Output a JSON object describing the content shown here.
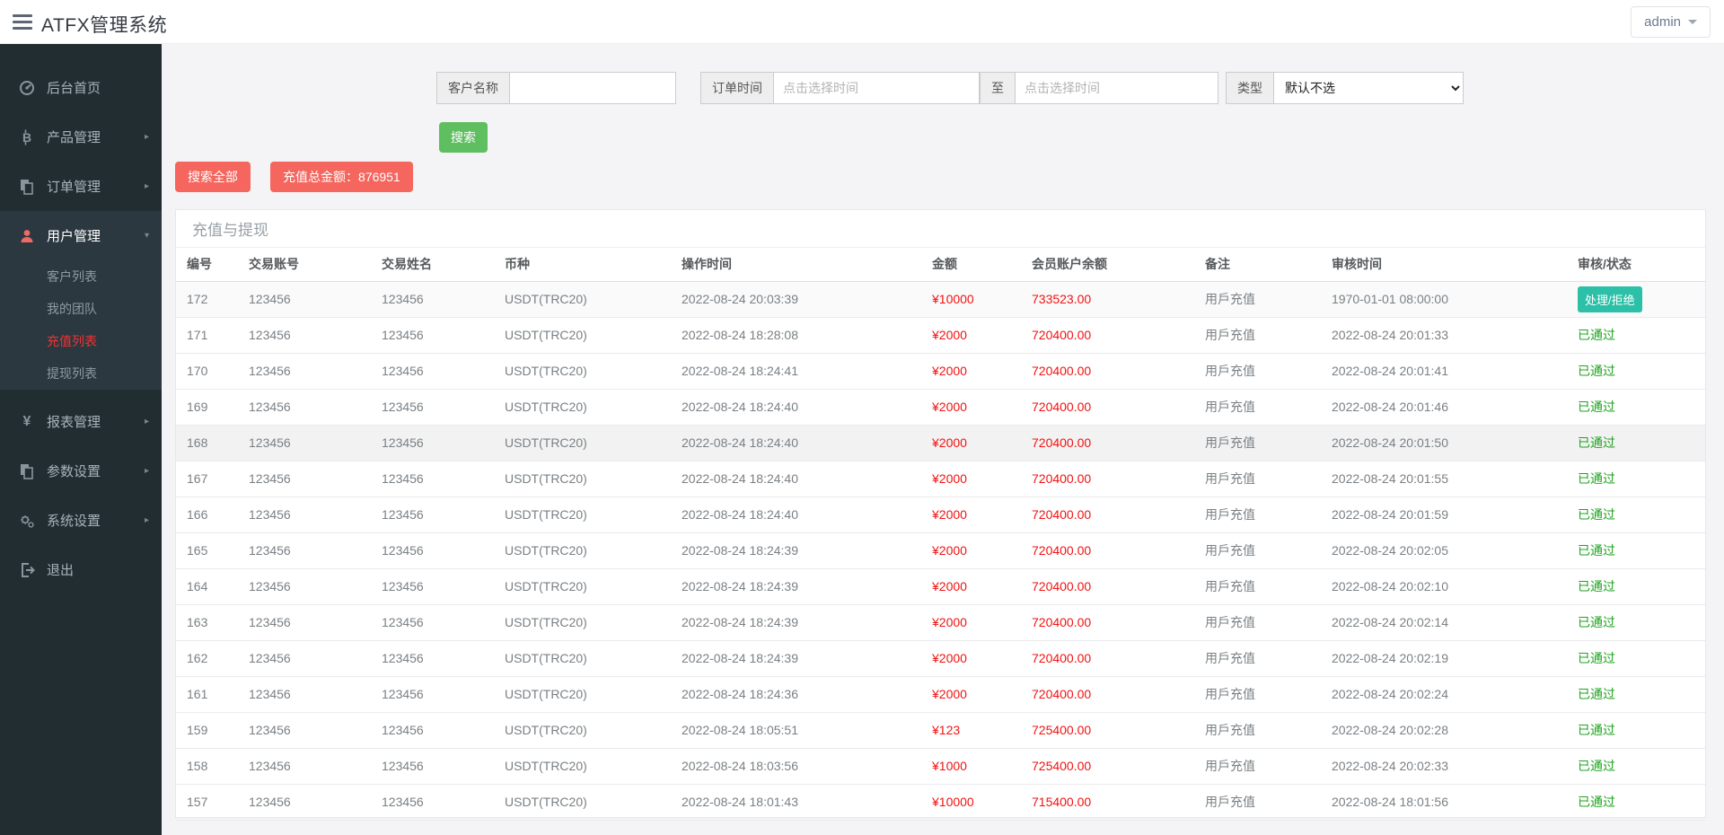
{
  "header": {
    "title": "ATFX管理系统",
    "user_menu": "admin"
  },
  "sidebar": {
    "items": [
      {
        "label": "后台首页",
        "icon": "dashboard-icon"
      },
      {
        "label": "产品管理",
        "icon": "bitcoin-icon"
      },
      {
        "label": "订单管理",
        "icon": "orders-icon"
      },
      {
        "label": "用户管理",
        "icon": "user-icon",
        "children": [
          {
            "label": "客户列表"
          },
          {
            "label": "我的团队"
          },
          {
            "label": "充值列表",
            "active": true
          },
          {
            "label": "提现列表"
          }
        ]
      },
      {
        "label": "报表管理",
        "icon": "yen-icon"
      },
      {
        "label": "参数设置",
        "icon": "params-icon"
      },
      {
        "label": "系统设置",
        "icon": "gears-icon"
      },
      {
        "label": "退出",
        "icon": "logout-icon"
      }
    ]
  },
  "filters": {
    "customer_name_label": "客户名称",
    "customer_name_value": "",
    "order_time_label": "订单时间",
    "time_placeholder": "点击选择时间",
    "to_label": "至",
    "type_label": "类型",
    "type_value": "默认不选",
    "search_button": "搜索",
    "search_all_button": "搜索全部",
    "recharge_total_button": "充值总金额：876951"
  },
  "panel": {
    "title": "充值与提现",
    "columns": [
      "编号",
      "交易账号",
      "交易姓名",
      "币种",
      "操作时间",
      "金额",
      "会员账户余额",
      "备注",
      "审核时间",
      "审核/状态"
    ],
    "rows": [
      {
        "id": "172",
        "account": "123456",
        "name": "123456",
        "currency": "USDT(TRC20)",
        "op_time": "2022-08-24 20:03:39",
        "amount": "¥10000",
        "balance": "733523.00",
        "note": "用戶充值",
        "audit_time": "1970-01-01 08:00:00",
        "status": "处理/拒绝",
        "status_type": "button",
        "bg": "#fafafa"
      },
      {
        "id": "171",
        "account": "123456",
        "name": "123456",
        "currency": "USDT(TRC20)",
        "op_time": "2022-08-24 18:28:08",
        "amount": "¥2000",
        "balance": "720400.00",
        "note": "用戶充值",
        "audit_time": "2022-08-24 20:01:33",
        "status": "已通过",
        "status_type": "text",
        "bg": null
      },
      {
        "id": "170",
        "account": "123456",
        "name": "123456",
        "currency": "USDT(TRC20)",
        "op_time": "2022-08-24 18:24:41",
        "amount": "¥2000",
        "balance": "720400.00",
        "note": "用戶充值",
        "audit_time": "2022-08-24 20:01:41",
        "status": "已通过",
        "status_type": "text",
        "bg": null
      },
      {
        "id": "169",
        "account": "123456",
        "name": "123456",
        "currency": "USDT(TRC20)",
        "op_time": "2022-08-24 18:24:40",
        "amount": "¥2000",
        "balance": "720400.00",
        "note": "用戶充值",
        "audit_time": "2022-08-24 20:01:46",
        "status": "已通过",
        "status_type": "text",
        "bg": null
      },
      {
        "id": "168",
        "account": "123456",
        "name": "123456",
        "currency": "USDT(TRC20)",
        "op_time": "2022-08-24 18:24:40",
        "amount": "¥2000",
        "balance": "720400.00",
        "note": "用戶充值",
        "audit_time": "2022-08-24 20:01:50",
        "status": "已通过",
        "status_type": "text",
        "bg": "#f2f2f2"
      },
      {
        "id": "167",
        "account": "123456",
        "name": "123456",
        "currency": "USDT(TRC20)",
        "op_time": "2022-08-24 18:24:40",
        "amount": "¥2000",
        "balance": "720400.00",
        "note": "用戶充值",
        "audit_time": "2022-08-24 20:01:55",
        "status": "已通过",
        "status_type": "text",
        "bg": null
      },
      {
        "id": "166",
        "account": "123456",
        "name": "123456",
        "currency": "USDT(TRC20)",
        "op_time": "2022-08-24 18:24:40",
        "amount": "¥2000",
        "balance": "720400.00",
        "note": "用戶充值",
        "audit_time": "2022-08-24 20:01:59",
        "status": "已通过",
        "status_type": "text",
        "bg": null
      },
      {
        "id": "165",
        "account": "123456",
        "name": "123456",
        "currency": "USDT(TRC20)",
        "op_time": "2022-08-24 18:24:39",
        "amount": "¥2000",
        "balance": "720400.00",
        "note": "用戶充值",
        "audit_time": "2022-08-24 20:02:05",
        "status": "已通过",
        "status_type": "text",
        "bg": null
      },
      {
        "id": "164",
        "account": "123456",
        "name": "123456",
        "currency": "USDT(TRC20)",
        "op_time": "2022-08-24 18:24:39",
        "amount": "¥2000",
        "balance": "720400.00",
        "note": "用戶充值",
        "audit_time": "2022-08-24 20:02:10",
        "status": "已通过",
        "status_type": "text",
        "bg": null
      },
      {
        "id": "163",
        "account": "123456",
        "name": "123456",
        "currency": "USDT(TRC20)",
        "op_time": "2022-08-24 18:24:39",
        "amount": "¥2000",
        "balance": "720400.00",
        "note": "用戶充值",
        "audit_time": "2022-08-24 20:02:14",
        "status": "已通过",
        "status_type": "text",
        "bg": null
      },
      {
        "id": "162",
        "account": "123456",
        "name": "123456",
        "currency": "USDT(TRC20)",
        "op_time": "2022-08-24 18:24:39",
        "amount": "¥2000",
        "balance": "720400.00",
        "note": "用戶充值",
        "audit_time": "2022-08-24 20:02:19",
        "status": "已通过",
        "status_type": "text",
        "bg": null
      },
      {
        "id": "161",
        "account": "123456",
        "name": "123456",
        "currency": "USDT(TRC20)",
        "op_time": "2022-08-24 18:24:36",
        "amount": "¥2000",
        "balance": "720400.00",
        "note": "用戶充值",
        "audit_time": "2022-08-24 20:02:24",
        "status": "已通过",
        "status_type": "text",
        "bg": null
      },
      {
        "id": "159",
        "account": "123456",
        "name": "123456",
        "currency": "USDT(TRC20)",
        "op_time": "2022-08-24 18:05:51",
        "amount": "¥123",
        "balance": "725400.00",
        "note": "用戶充值",
        "audit_time": "2022-08-24 20:02:28",
        "status": "已通过",
        "status_type": "text",
        "bg": null
      },
      {
        "id": "158",
        "account": "123456",
        "name": "123456",
        "currency": "USDT(TRC20)",
        "op_time": "2022-08-24 18:03:56",
        "amount": "¥1000",
        "balance": "725400.00",
        "note": "用戶充值",
        "audit_time": "2022-08-24 20:02:33",
        "status": "已通过",
        "status_type": "text",
        "bg": null
      },
      {
        "id": "157",
        "account": "123456",
        "name": "123456",
        "currency": "USDT(TRC20)",
        "op_time": "2022-08-24 18:01:43",
        "amount": "¥10000",
        "balance": "715400.00",
        "note": "用戶充值",
        "audit_time": "2022-08-24 18:01:56",
        "status": "已通过",
        "status_type": "text",
        "bg": null
      }
    ]
  },
  "colors": {
    "sidebar_bg": "#222d32",
    "sidebar_active_red": "#f03333",
    "accent_red_button": "#f4665e",
    "accent_green_button": "#5fbf60",
    "amount_red": "#f21212",
    "status_green": "#1fa31f",
    "badge_teal": "#2bc0a7"
  }
}
